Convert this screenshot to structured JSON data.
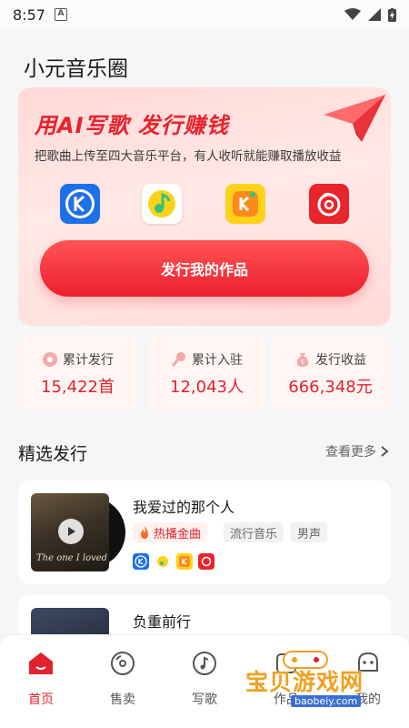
{
  "status_bar": {
    "time": "8:57",
    "notif": "A"
  },
  "app_title": "小元音乐圈",
  "banner": {
    "title": "用AI写歌 发行赚钱",
    "subtitle": "把歌曲上传至四大音乐平台，有人收听就能赚取播放收益",
    "platforms": [
      {
        "name": "kugou-icon",
        "glyph": "K",
        "bg": "#1f6fe8"
      },
      {
        "name": "qqmusic-icon",
        "glyph": "♫",
        "bg": "#ffffff"
      },
      {
        "name": "kuwo-icon",
        "glyph": "K",
        "bg": "#ffd21a"
      },
      {
        "name": "netease-icon",
        "glyph": "◎",
        "bg": "#e8242c"
      }
    ],
    "button_label": "发行我的作品"
  },
  "stats": [
    {
      "label": "累计发行",
      "value": "15,422首"
    },
    {
      "label": "累计入驻",
      "value": "12,043人"
    },
    {
      "label": "发行收益",
      "value": "666,348元"
    }
  ],
  "featured": {
    "title": "精选发行",
    "more_label": "查看更多",
    "songs": [
      {
        "title": "我爱过的那个人",
        "cover_text": "The one I loved",
        "tags": [
          "热播金曲",
          "流行音乐",
          "男声"
        ]
      },
      {
        "title": "负重前行"
      }
    ]
  },
  "tabs": [
    {
      "label": "首页"
    },
    {
      "label": "售卖"
    },
    {
      "label": "写歌"
    },
    {
      "label": "作品"
    },
    {
      "label": "我的"
    }
  ],
  "watermark": {
    "text": "宝贝游戏网",
    "url": "baobeiy.com"
  },
  "colors": {
    "accent": "#e0232e",
    "banner_bg": "#ffe3e0"
  }
}
